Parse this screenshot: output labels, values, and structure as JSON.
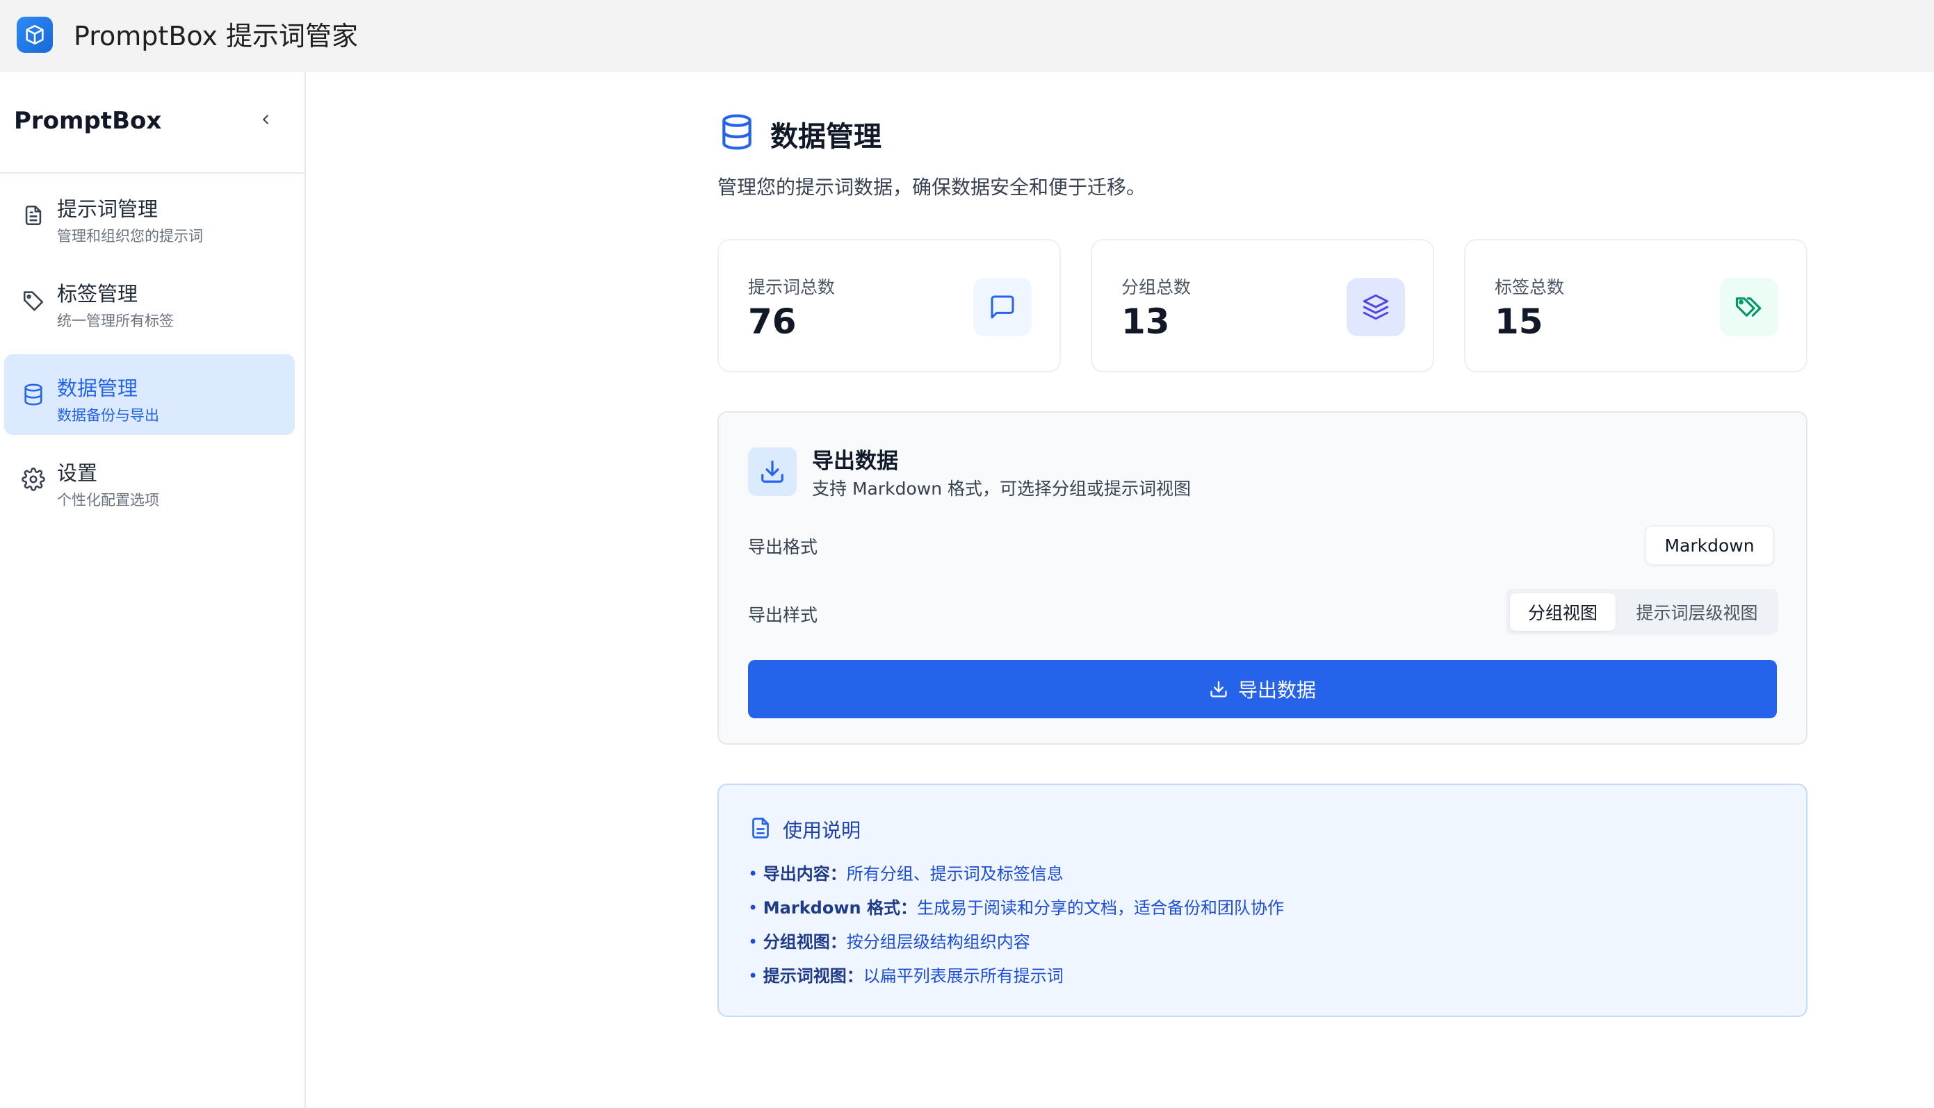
{
  "window": {
    "title": "PromptBox 提示词管家"
  },
  "sidebar": {
    "brand": "PromptBox",
    "items": [
      {
        "label": "提示词管理",
        "sub": "管理和组织您的提示词",
        "icon": "file-text-icon"
      },
      {
        "label": "标签管理",
        "sub": "统一管理所有标签",
        "icon": "tag-icon"
      },
      {
        "label": "数据管理",
        "sub": "数据备份与导出",
        "icon": "database-icon",
        "active": true
      },
      {
        "label": "设置",
        "sub": "个性化配置选项",
        "icon": "gear-icon"
      }
    ]
  },
  "page": {
    "title": "数据管理",
    "description": "管理您的提示词数据，确保数据安全和便于迁移。"
  },
  "stats": [
    {
      "label": "提示词总数",
      "value": "76",
      "icon": "message-square-icon"
    },
    {
      "label": "分组总数",
      "value": "13",
      "icon": "layers-icon"
    },
    {
      "label": "标签总数",
      "value": "15",
      "icon": "tags-icon"
    }
  ],
  "export": {
    "title": "导出数据",
    "subtitle": "支持 Markdown 格式，可选择分组或提示词视图",
    "format_label": "导出格式",
    "format_value": "Markdown",
    "style_label": "导出样式",
    "style_options": [
      "分组视图",
      "提示词层级视图"
    ],
    "style_selected": "分组视图",
    "button_label": "导出数据"
  },
  "help": {
    "title": "使用说明",
    "items": [
      {
        "key": "导出内容：",
        "text": "所有分组、提示词及标签信息"
      },
      {
        "key": "Markdown 格式：",
        "text": "生成易于阅读和分享的文档，适合备份和团队协作"
      },
      {
        "key": "分组视图：",
        "text": "按分组层级结构组织内容"
      },
      {
        "key": "提示词视图：",
        "text": "以扁平列表展示所有提示词"
      }
    ]
  },
  "colors": {
    "accent": "#2563eb",
    "active_nav_bg": "#dbeafe",
    "help_bg": "#eff6ff",
    "tags_icon": "#059669",
    "layers_icon": "#4f46e5"
  }
}
